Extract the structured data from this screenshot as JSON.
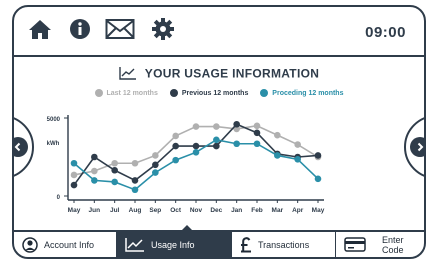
{
  "topbar": {
    "time": "09:00",
    "icons": [
      "home-icon",
      "info-icon",
      "mail-icon",
      "settings-icon"
    ]
  },
  "chart_title": "YOUR USAGE INFORMATION",
  "colors": {
    "dark": "#2f3c4a",
    "last12": "#b0b0b0",
    "previous12": "#2f3c4a",
    "proceeding12": "#2a8fa8"
  },
  "legend": [
    {
      "label": "Last 12 months",
      "color": "#b0b0b0"
    },
    {
      "label": "Previous 12 months",
      "color": "#2f3c4a"
    },
    {
      "label": "Proceding 12 months",
      "color": "#2a8fa8"
    }
  ],
  "chart_data": {
    "type": "line",
    "categories": [
      "May",
      "Jun",
      "Jul",
      "Aug",
      "Sep",
      "Oct",
      "Nov",
      "Dec",
      "Jan",
      "Feb",
      "Mar",
      "Apr",
      "May"
    ],
    "ylabel": "kWh",
    "yticks": [
      "5000",
      "0"
    ],
    "ylim": [
      0,
      5000
    ],
    "series": [
      {
        "name": "Last 12 months",
        "color": "#b0b0b0",
        "values": [
          1350,
          1600,
          2100,
          2100,
          2600,
          3850,
          4450,
          4450,
          4300,
          4500,
          3900,
          3300,
          2500
        ]
      },
      {
        "name": "Previous 12 months",
        "color": "#2f3c4a",
        "values": [
          700,
          2500,
          1650,
          1000,
          2000,
          3200,
          3200,
          3200,
          4600,
          4050,
          2700,
          2500,
          2600
        ]
      },
      {
        "name": "Proceding 12 months",
        "color": "#2a8fa8",
        "values": [
          2100,
          1000,
          900,
          400,
          1500,
          2300,
          2800,
          3600,
          3350,
          3350,
          2600,
          2350,
          1100
        ]
      }
    ]
  },
  "bottom_tabs": [
    {
      "label": "Account Info",
      "icon": "account-icon"
    },
    {
      "label": "Usage Info",
      "icon": "usage-chart-icon"
    },
    {
      "label": "Transactions",
      "icon": "pound-icon"
    },
    {
      "label": "Enter Code",
      "icon": "card-icon"
    }
  ]
}
